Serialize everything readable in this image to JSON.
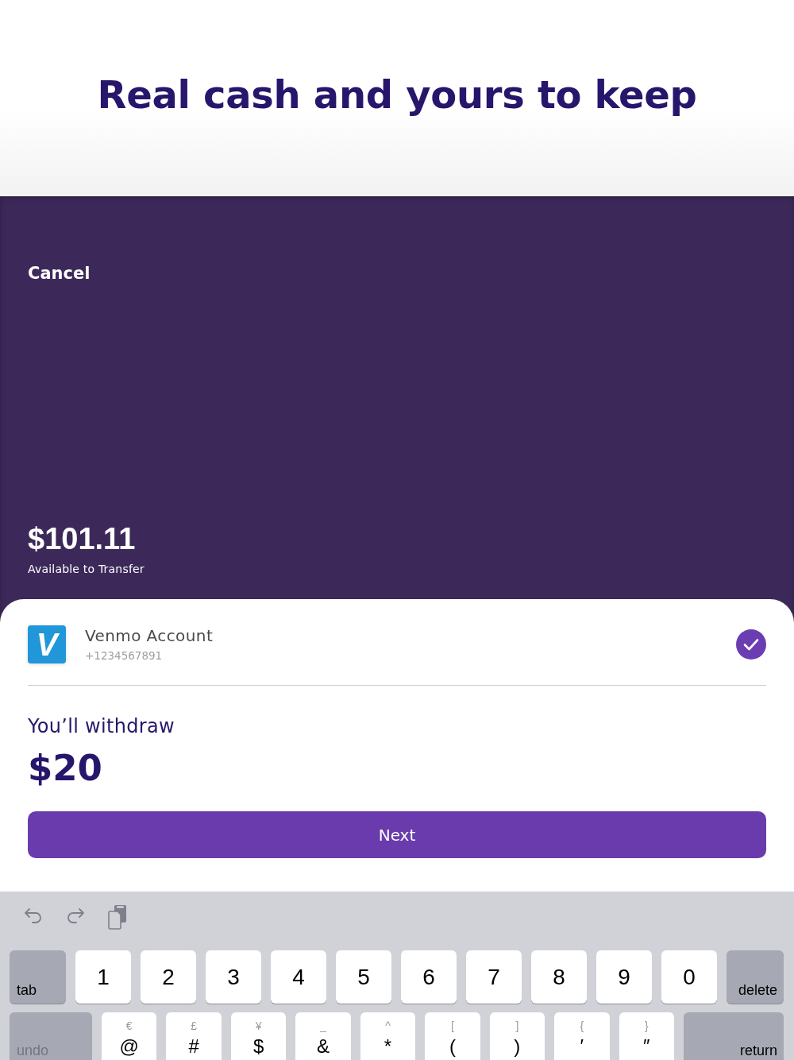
{
  "header": {
    "title": "Real cash and yours to keep"
  },
  "balance_panel": {
    "cancel": "Cancel",
    "amount": "$101.11",
    "caption": "Available to Transfer"
  },
  "account": {
    "logo": "V",
    "name": "Venmo Account",
    "phone": "+1234567891",
    "selected": true
  },
  "withdraw": {
    "label": "You’ll withdraw",
    "amount": "$20"
  },
  "next_button": {
    "label": "Next"
  },
  "keyboard": {
    "rows": [
      {
        "keys": [
          {
            "kind": "tab",
            "label": "tab",
            "disabled": false
          },
          {
            "kind": "digit",
            "label": "1",
            "disabled": false
          },
          {
            "kind": "digit",
            "label": "2",
            "disabled": false
          },
          {
            "kind": "digit",
            "label": "3",
            "disabled": false
          },
          {
            "kind": "digit",
            "label": "4",
            "disabled": false
          },
          {
            "kind": "digit",
            "label": "5",
            "disabled": false
          },
          {
            "kind": "digit",
            "label": "6",
            "disabled": false
          },
          {
            "kind": "digit",
            "label": "7",
            "disabled": false
          },
          {
            "kind": "digit",
            "label": "8",
            "disabled": false
          },
          {
            "kind": "digit",
            "label": "9",
            "disabled": false
          },
          {
            "kind": "digit",
            "label": "0",
            "disabled": false
          },
          {
            "kind": "delete",
            "label": "delete",
            "disabled": false
          }
        ]
      },
      {
        "keys": [
          {
            "kind": "undo",
            "label": "undo",
            "disabled": true
          },
          {
            "kind": "symbol",
            "label": "@",
            "alt": "€",
            "disabled": false
          },
          {
            "kind": "symbol",
            "label": "#",
            "alt": "£",
            "disabled": false
          },
          {
            "kind": "symbol",
            "label": "$",
            "alt": "¥",
            "disabled": false
          },
          {
            "kind": "symbol",
            "label": "&",
            "alt": "_",
            "disabled": false
          },
          {
            "kind": "symbol",
            "label": "*",
            "alt": "^",
            "disabled": false
          },
          {
            "kind": "symbol",
            "label": "(",
            "alt": "[",
            "disabled": false
          },
          {
            "kind": "symbol",
            "label": ")",
            "alt": "]",
            "disabled": false
          },
          {
            "kind": "symbol",
            "label": "′",
            "alt": "{",
            "disabled": false
          },
          {
            "kind": "symbol",
            "label": "″",
            "alt": "}",
            "disabled": false
          },
          {
            "kind": "return",
            "label": "return",
            "disabled": false
          }
        ]
      }
    ]
  }
}
